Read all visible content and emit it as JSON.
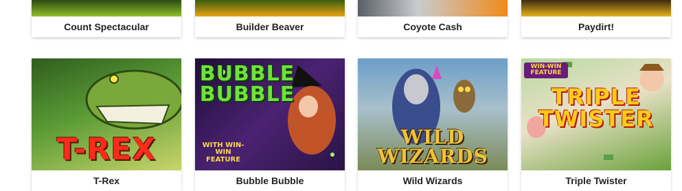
{
  "rows": [
    {
      "games": [
        {
          "title": "Count Spectacular",
          "art_text": "",
          "colors": [
            "#2c4a12",
            "#8fbf2a"
          ]
        },
        {
          "title": "Builder Beaver",
          "art_text": "",
          "colors": [
            "#3b5d0f",
            "#e8a312"
          ]
        },
        {
          "title": "Coyote Cash",
          "art_text": "",
          "colors": [
            "#5a5f66",
            "#f08a1a"
          ]
        },
        {
          "title": "Paydirt!",
          "art_text": "",
          "colors": [
            "#3d2a10",
            "#e6b21f"
          ]
        }
      ]
    },
    {
      "games": [
        {
          "title": "T-Rex",
          "art_text": "T-REX",
          "icon": "trex-art",
          "colors": [
            "#3f7a2a",
            "#d4dc6a"
          ],
          "text_color": "#ff2b1a"
        },
        {
          "title": "Bubble Bubble",
          "art_text": "BUBBLE BUBBLE",
          "icon": "witch-art",
          "colors": [
            "#2a1445",
            "#6a2f8a"
          ],
          "text_color": "#6de23a",
          "badge": "WITH WIN-WIN FEATURE"
        },
        {
          "title": "Wild Wizards",
          "art_text": "WILD WIZARDS",
          "icon": "wizard-art",
          "colors": [
            "#5c8fb8",
            "#8fa06a"
          ],
          "text_color": "#f0c23a"
        },
        {
          "title": "Triple Twister",
          "art_text": "TRIPLE TWISTER",
          "icon": "twister-art",
          "colors": [
            "#6a9c3a",
            "#f5d9b0"
          ],
          "text_color": "#ffcc1a",
          "badge": "WIN-WIN FEATURE"
        }
      ]
    }
  ]
}
